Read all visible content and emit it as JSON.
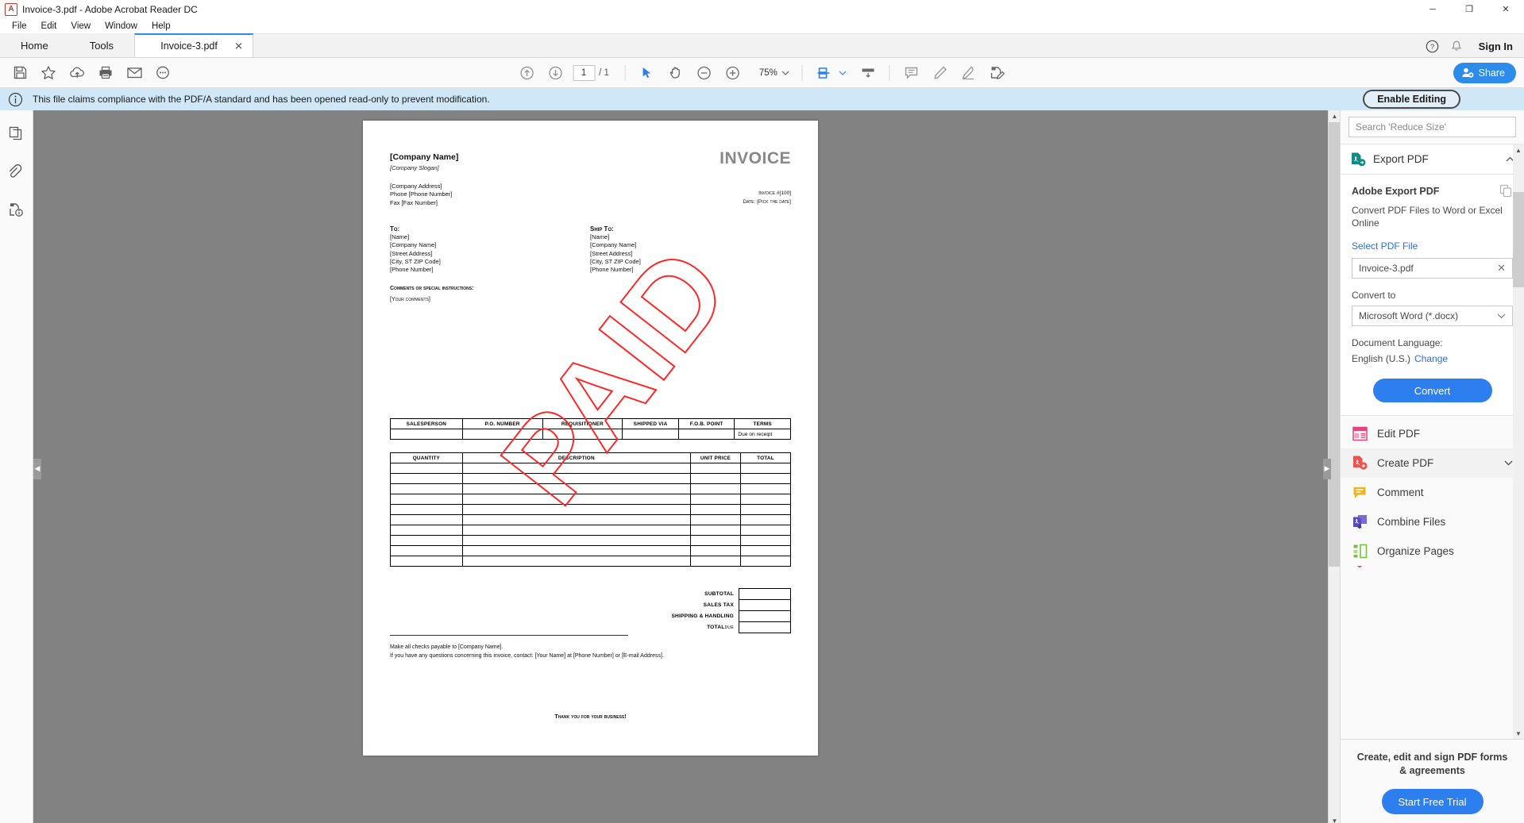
{
  "window": {
    "title": "Invoice-3.pdf - Adobe Acrobat Reader DC",
    "app_icon": "pdf-file-icon",
    "minimize": "─",
    "maximize": "❐",
    "close": "✕"
  },
  "menubar": {
    "items": [
      "File",
      "Edit",
      "View",
      "Window",
      "Help"
    ]
  },
  "tabstrip": {
    "home": "Home",
    "tools": "Tools",
    "doc_tab": "Invoice-3.pdf",
    "close_glyph": "✕",
    "sign_in": "Sign In"
  },
  "toolbar": {
    "left_icons": [
      "save-icon",
      "star-icon",
      "cloud-upload-icon",
      "print-icon",
      "email-icon",
      "search-text-icon"
    ],
    "page_current": "1",
    "page_total": "/ 1",
    "zoom_level": "75%",
    "right_icons": [
      "comment-icon",
      "highlight-icon",
      "sign-icon",
      "fill-and-sign-icon"
    ],
    "share_label": "Share"
  },
  "notification": {
    "icon": "info-icon",
    "message": "This file claims compliance with the PDF/A standard and has been opened read-only to prevent modification.",
    "button": "Enable Editing"
  },
  "left_rail": {
    "icons": [
      "page-thumbnails-icon",
      "attachments-icon",
      "document-info-icon"
    ]
  },
  "document": {
    "company_name": "[Company Name]",
    "company_slogan": "[Company Slogan]",
    "company_address": [
      "[Company Address]",
      "Phone [Phone Number]",
      "Fax [Fax Number]"
    ],
    "invoice_heading": "INVOICE",
    "invoice_number": "Invoice #[100]",
    "invoice_date": "Date: [Pick the date]",
    "to_label": "To:",
    "to_lines": [
      "[Name]",
      "[Company Name]",
      "[Street Address]",
      "[City, ST ZIP Code]",
      "[Phone Number]"
    ],
    "shipto_label": "Ship To:",
    "shipto_lines": [
      "[Name]",
      "[Company Name]",
      "[Street Address]",
      "[City, ST ZIP Code]",
      "[Phone Number]"
    ],
    "comments_label": "Comments or special instructions:",
    "comments_value": "[Your comments]",
    "stamp": "PAID",
    "table1_headers": [
      "SALESPERSON",
      "P.O. NUMBER",
      "REQUISITIONER",
      "SHIPPED VIA",
      "F.O.B. POINT",
      "TERMS"
    ],
    "table1_row": [
      "",
      "",
      "",
      "",
      "",
      "Due on receipt"
    ],
    "table2_headers": [
      "QUANTITY",
      "DESCRIPTION",
      "UNIT PRICE",
      "TOTAL"
    ],
    "table2_empty_rows": 10,
    "totals": [
      {
        "label": "SUBTOTAL",
        "value": ""
      },
      {
        "label": "SALES TAX",
        "value": ""
      },
      {
        "label": "SHIPPING & HANDLING",
        "value": ""
      },
      {
        "label": "TOTAL",
        "sublabel": "DUE",
        "value": ""
      }
    ],
    "footer_line1": "Make all checks payable to [Company Name].",
    "footer_line2": "If you have any questions concerning this invoice, contact: [Your Name] at [Phone Number] or [E-mail Address].",
    "thanks": "Thank you for your business!"
  },
  "right_panel": {
    "search_placeholder": "Search 'Reduce Size'",
    "export_header": "Export PDF",
    "export_title": "Adobe Export PDF",
    "export_subtitle": "Convert PDF Files to Word or Excel Online",
    "select_pdf_link": "Select PDF File",
    "selected_file": "Invoice-3.pdf",
    "clear_glyph": "✕",
    "convert_to_label": "Convert to",
    "convert_to_value": "Microsoft Word (*.docx)",
    "document_language_label": "Document Language:",
    "document_language_value": "English (U.S.)",
    "change_link": "Change",
    "convert_button": "Convert",
    "tools": [
      {
        "label": "Edit PDF",
        "icon": "edit-pdf-icon",
        "chevron": false
      },
      {
        "label": "Create PDF",
        "icon": "create-pdf-icon",
        "chevron": true
      },
      {
        "label": "Comment",
        "icon": "comment-icon",
        "chevron": false
      },
      {
        "label": "Combine Files",
        "icon": "combine-files-icon",
        "chevron": false
      },
      {
        "label": "Organize Pages",
        "icon": "organize-pages-icon",
        "chevron": false
      }
    ],
    "promo_text": "Create, edit and sign PDF forms & agreements",
    "promo_button": "Start Free Trial"
  },
  "colors": {
    "accent_blue": "#2d7ff0",
    "notification_bg": "#cfe7f7",
    "stamp_red": "#fb2a2a",
    "export_teal": "#128a85"
  }
}
